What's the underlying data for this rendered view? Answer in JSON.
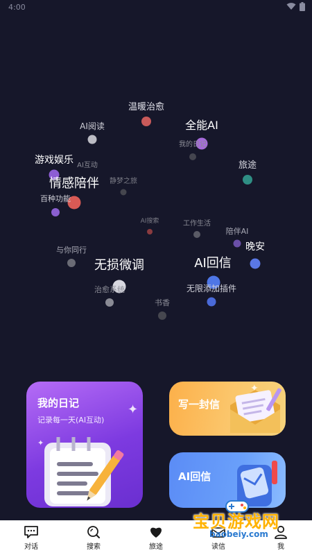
{
  "status_bar": {
    "time": "4:00"
  },
  "cloud": {
    "items": [
      {
        "label": "温暖治愈",
        "color": "#c85a5a"
      },
      {
        "label": "AI阅读",
        "color": "#bcbcc4"
      },
      {
        "label": "全能AI",
        "color": "#a56bd9"
      },
      {
        "label": "我的日记",
        "color": "#44454f"
      },
      {
        "label": "游戏娱乐",
        "color": "#8d5dd4"
      },
      {
        "label": "AI互动",
        "color": "#5f6080"
      },
      {
        "label": "旅途",
        "color": "#2f8e84"
      },
      {
        "label": "情感陪伴",
        "color": "#d95a55"
      },
      {
        "label": "静梦之旅",
        "color": "#45464e"
      },
      {
        "label": "百种功能",
        "color": "#8a5fd0"
      },
      {
        "label": "AI搜索",
        "color": "#8a3b3f"
      },
      {
        "label": "工作生活",
        "color": "#5a5b66"
      },
      {
        "label": "陪伴AI",
        "color": "#6a4fa8"
      },
      {
        "label": "晚安",
        "color": "#5a78e6"
      },
      {
        "label": "与你同行",
        "color": "#6a6b75"
      },
      {
        "label": "无损微调",
        "color": "#d8d8e0"
      },
      {
        "label": "AI回信",
        "color": "#4e76e6"
      },
      {
        "label": "无限添加插件",
        "color": "#4a6ad8"
      },
      {
        "label": "治愈系统",
        "color": "#8a8b95"
      },
      {
        "label": "书香",
        "color": "#46474f"
      }
    ]
  },
  "cards": {
    "diary": {
      "title": "我的日记",
      "subtitle": "记录每一天(AI互动)"
    },
    "letter": {
      "title": "写一封信"
    },
    "reply": {
      "title": "AI回信"
    }
  },
  "tabbar": {
    "items": [
      {
        "label": "对话",
        "icon": "chat-icon"
      },
      {
        "label": "搜索",
        "icon": "search-icon"
      },
      {
        "label": "旅途",
        "icon": "heart-icon"
      },
      {
        "label": "读信",
        "icon": "envelope-icon"
      },
      {
        "label": "我",
        "icon": "user-icon"
      }
    ]
  },
  "watermark": {
    "text": "宝贝游戏网",
    "url": "baobeiy.com"
  }
}
